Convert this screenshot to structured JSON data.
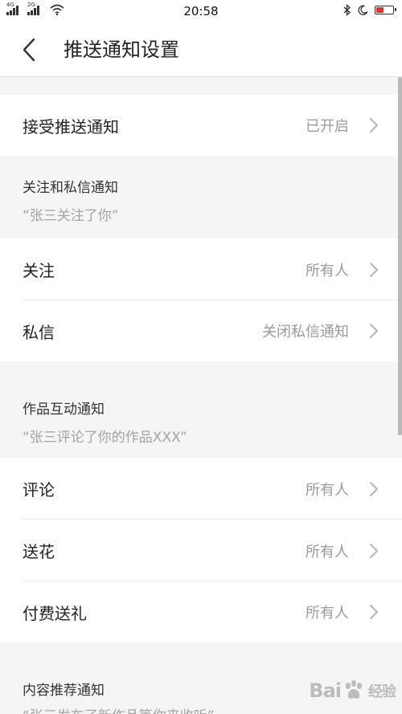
{
  "status_bar": {
    "net1": "4G",
    "net2": "2G",
    "time": "20:58",
    "icons": [
      "signal-icon",
      "signal-icon",
      "wifi-icon",
      "bluetooth-icon",
      "moon-icon",
      "battery-icon"
    ],
    "battery_color": "#e2332f"
  },
  "header": {
    "title": "推送通知设置"
  },
  "rows": {
    "push": {
      "label": "接受推送通知",
      "value": "已开启"
    },
    "follow": {
      "label": "关注",
      "value": "所有人"
    },
    "message": {
      "label": "私信",
      "value": "关闭私信通知"
    },
    "comment": {
      "label": "评论",
      "value": "所有人"
    },
    "flower": {
      "label": "送花",
      "value": "所有人"
    },
    "gift": {
      "label": "付费送礼",
      "value": "所有人"
    }
  },
  "sections": {
    "follow_msg": {
      "title": "关注和私信通知",
      "subtitle": "“张三关注了你”"
    },
    "works": {
      "title": "作品互动通知",
      "subtitle": "“张三评论了你的作品XXX”"
    },
    "recommend": {
      "title": "内容推荐通知",
      "subtitle": "“张三发布了新作品等你来收听”"
    }
  },
  "watermark": {
    "text_left": "Bai",
    "text_right": "经验"
  },
  "colors": {
    "background": "#f5f5f5",
    "card": "#ffffff",
    "primary_text": "#222222",
    "secondary_text": "#9a9a9a"
  }
}
